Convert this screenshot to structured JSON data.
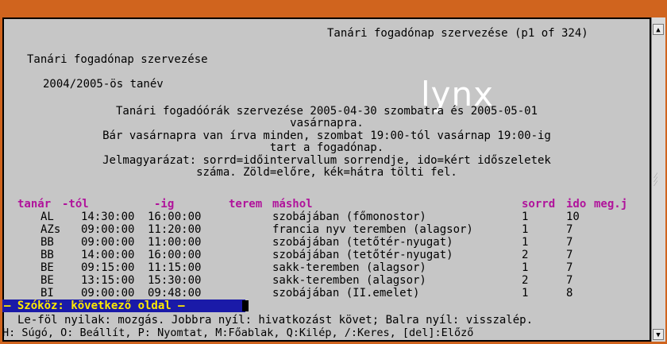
{
  "window": {
    "title": "Tanári fogadónap szervezése (p1 of 324)"
  },
  "logo_text": "lynx",
  "page": {
    "heading": "Tanári fogadónap szervezése",
    "year": "2004/2005-ös tanév",
    "intro": [
      "Tanári fogadóórák szervezése 2005-04-30 szombatra és 2005-05-01",
      "vasárnapra.",
      "Bár vasárnapra van írva minden, szombat 19:00-tól vasárnap 19:00-ig",
      "tart a fogadónap.",
      "Jelmagyarázat: sorrd=időintervallum sorrendje, ido=kért időszeletek",
      "száma. Zöld=előre, kék=hátra tölti fel."
    ],
    "table": {
      "headers": [
        "tanár",
        "-tól",
        "-ig",
        "terem",
        "máshol",
        "sorrd",
        "ido",
        "meg.j"
      ],
      "rows": [
        [
          "AL",
          "14:30:00",
          "16:00:00",
          "szobájában (főmonostor)",
          "1",
          "10"
        ],
        [
          "AZs",
          "09:00:00",
          "11:20:00",
          "francia nyv teremben (alagsor)",
          "1",
          "7"
        ],
        [
          "BB",
          "09:00:00",
          "11:00:00",
          "szobájában (tetőtér-nyugat)",
          "1",
          "7"
        ],
        [
          "BB",
          "14:00:00",
          "16:00:00",
          "szobájában (tetőtér-nyugat)",
          "2",
          "7"
        ],
        [
          "BE",
          "09:15:00",
          "11:15:00",
          "sakk-teremben (alagsor)",
          "1",
          "7"
        ],
        [
          "BE",
          "13:15:00",
          "15:30:00",
          "sakk-teremben (alagsor)",
          "2",
          "7"
        ],
        [
          "BI",
          "09:00:00",
          "09:48:00",
          "szobájában (II.emelet)",
          "1",
          "8"
        ]
      ]
    }
  },
  "status": {
    "prompt": "— Szóköz: következő oldal —",
    "help1": "Le-föl nyilak: mozgás. Jobbra nyíl: hivatkozást követ; Balra nyíl: visszalép.",
    "help2": "H: Súgó, O: Beállít, P: Nyomtat, M:Főablak, Q:Kilép, /:Keres, [del]:Előző"
  },
  "colors": {
    "background": "#c6c6c6",
    "header_magenta": "#b0139b",
    "status_bg": "#1a1aa8",
    "status_fg": "#ffea00",
    "frame": "#d0641e"
  }
}
